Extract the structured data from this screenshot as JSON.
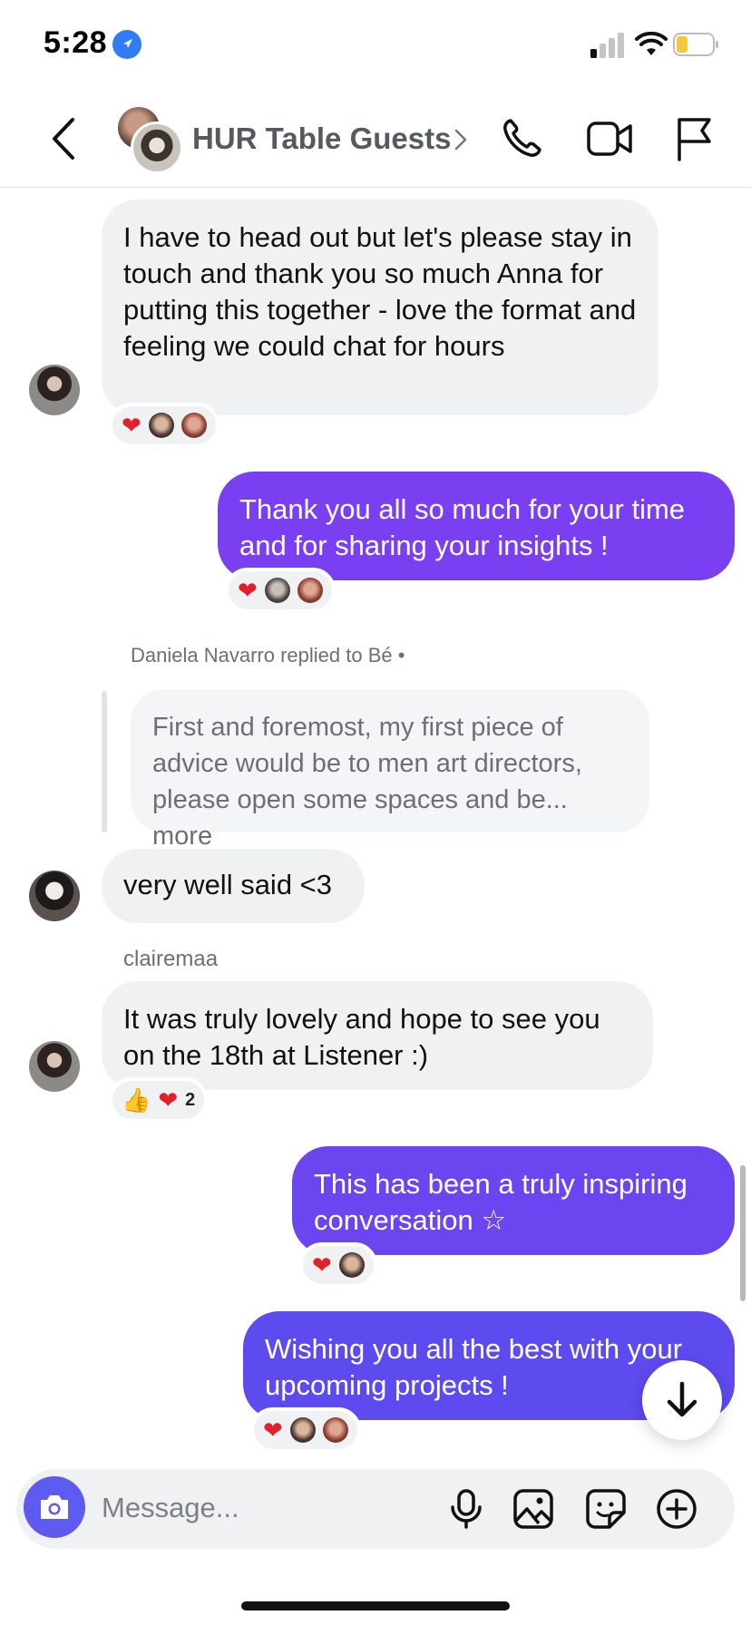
{
  "status_bar": {
    "time": "5:28"
  },
  "header": {
    "title": "HUR Table Guests",
    "icons": [
      "back-icon",
      "chevron-right-icon",
      "phone-icon",
      "video-icon",
      "flag-icon"
    ]
  },
  "messages": [
    {
      "id": "m1",
      "text": "I have to head out but let's please stay in touch and thank you so much Anna for putting this together - love the format and feeling we could chat for hours"
    },
    {
      "id": "m2",
      "text": "Thank you all so much for your time and for sharing your insights !"
    },
    {
      "id": "m3",
      "reply_meta": "Daniela Navarro replied to Bé",
      "reply_text": "First and foremost, my first piece of advice would be to men art directors, please open some spaces and be...",
      "reply_more": "more",
      "text": "very well said <3"
    },
    {
      "id": "m4",
      "sender": "clairemaa",
      "text": "It was truly lovely and hope to see you on the 18th at Listener :)",
      "reaction_count": "2"
    },
    {
      "id": "m5",
      "text": "This has been a truly inspiring conversation ☆"
    },
    {
      "id": "m6",
      "text": "Wishing you all the best with your upcoming projects !"
    }
  ],
  "composer": {
    "placeholder": "Message..."
  },
  "colors": {
    "outgoing_1": "#7b3ff2",
    "outgoing_2": "#6a45f0",
    "outgoing_3": "#5d4bf0",
    "camera": "#5d5bf0",
    "incoming": "#f0f1f3"
  }
}
